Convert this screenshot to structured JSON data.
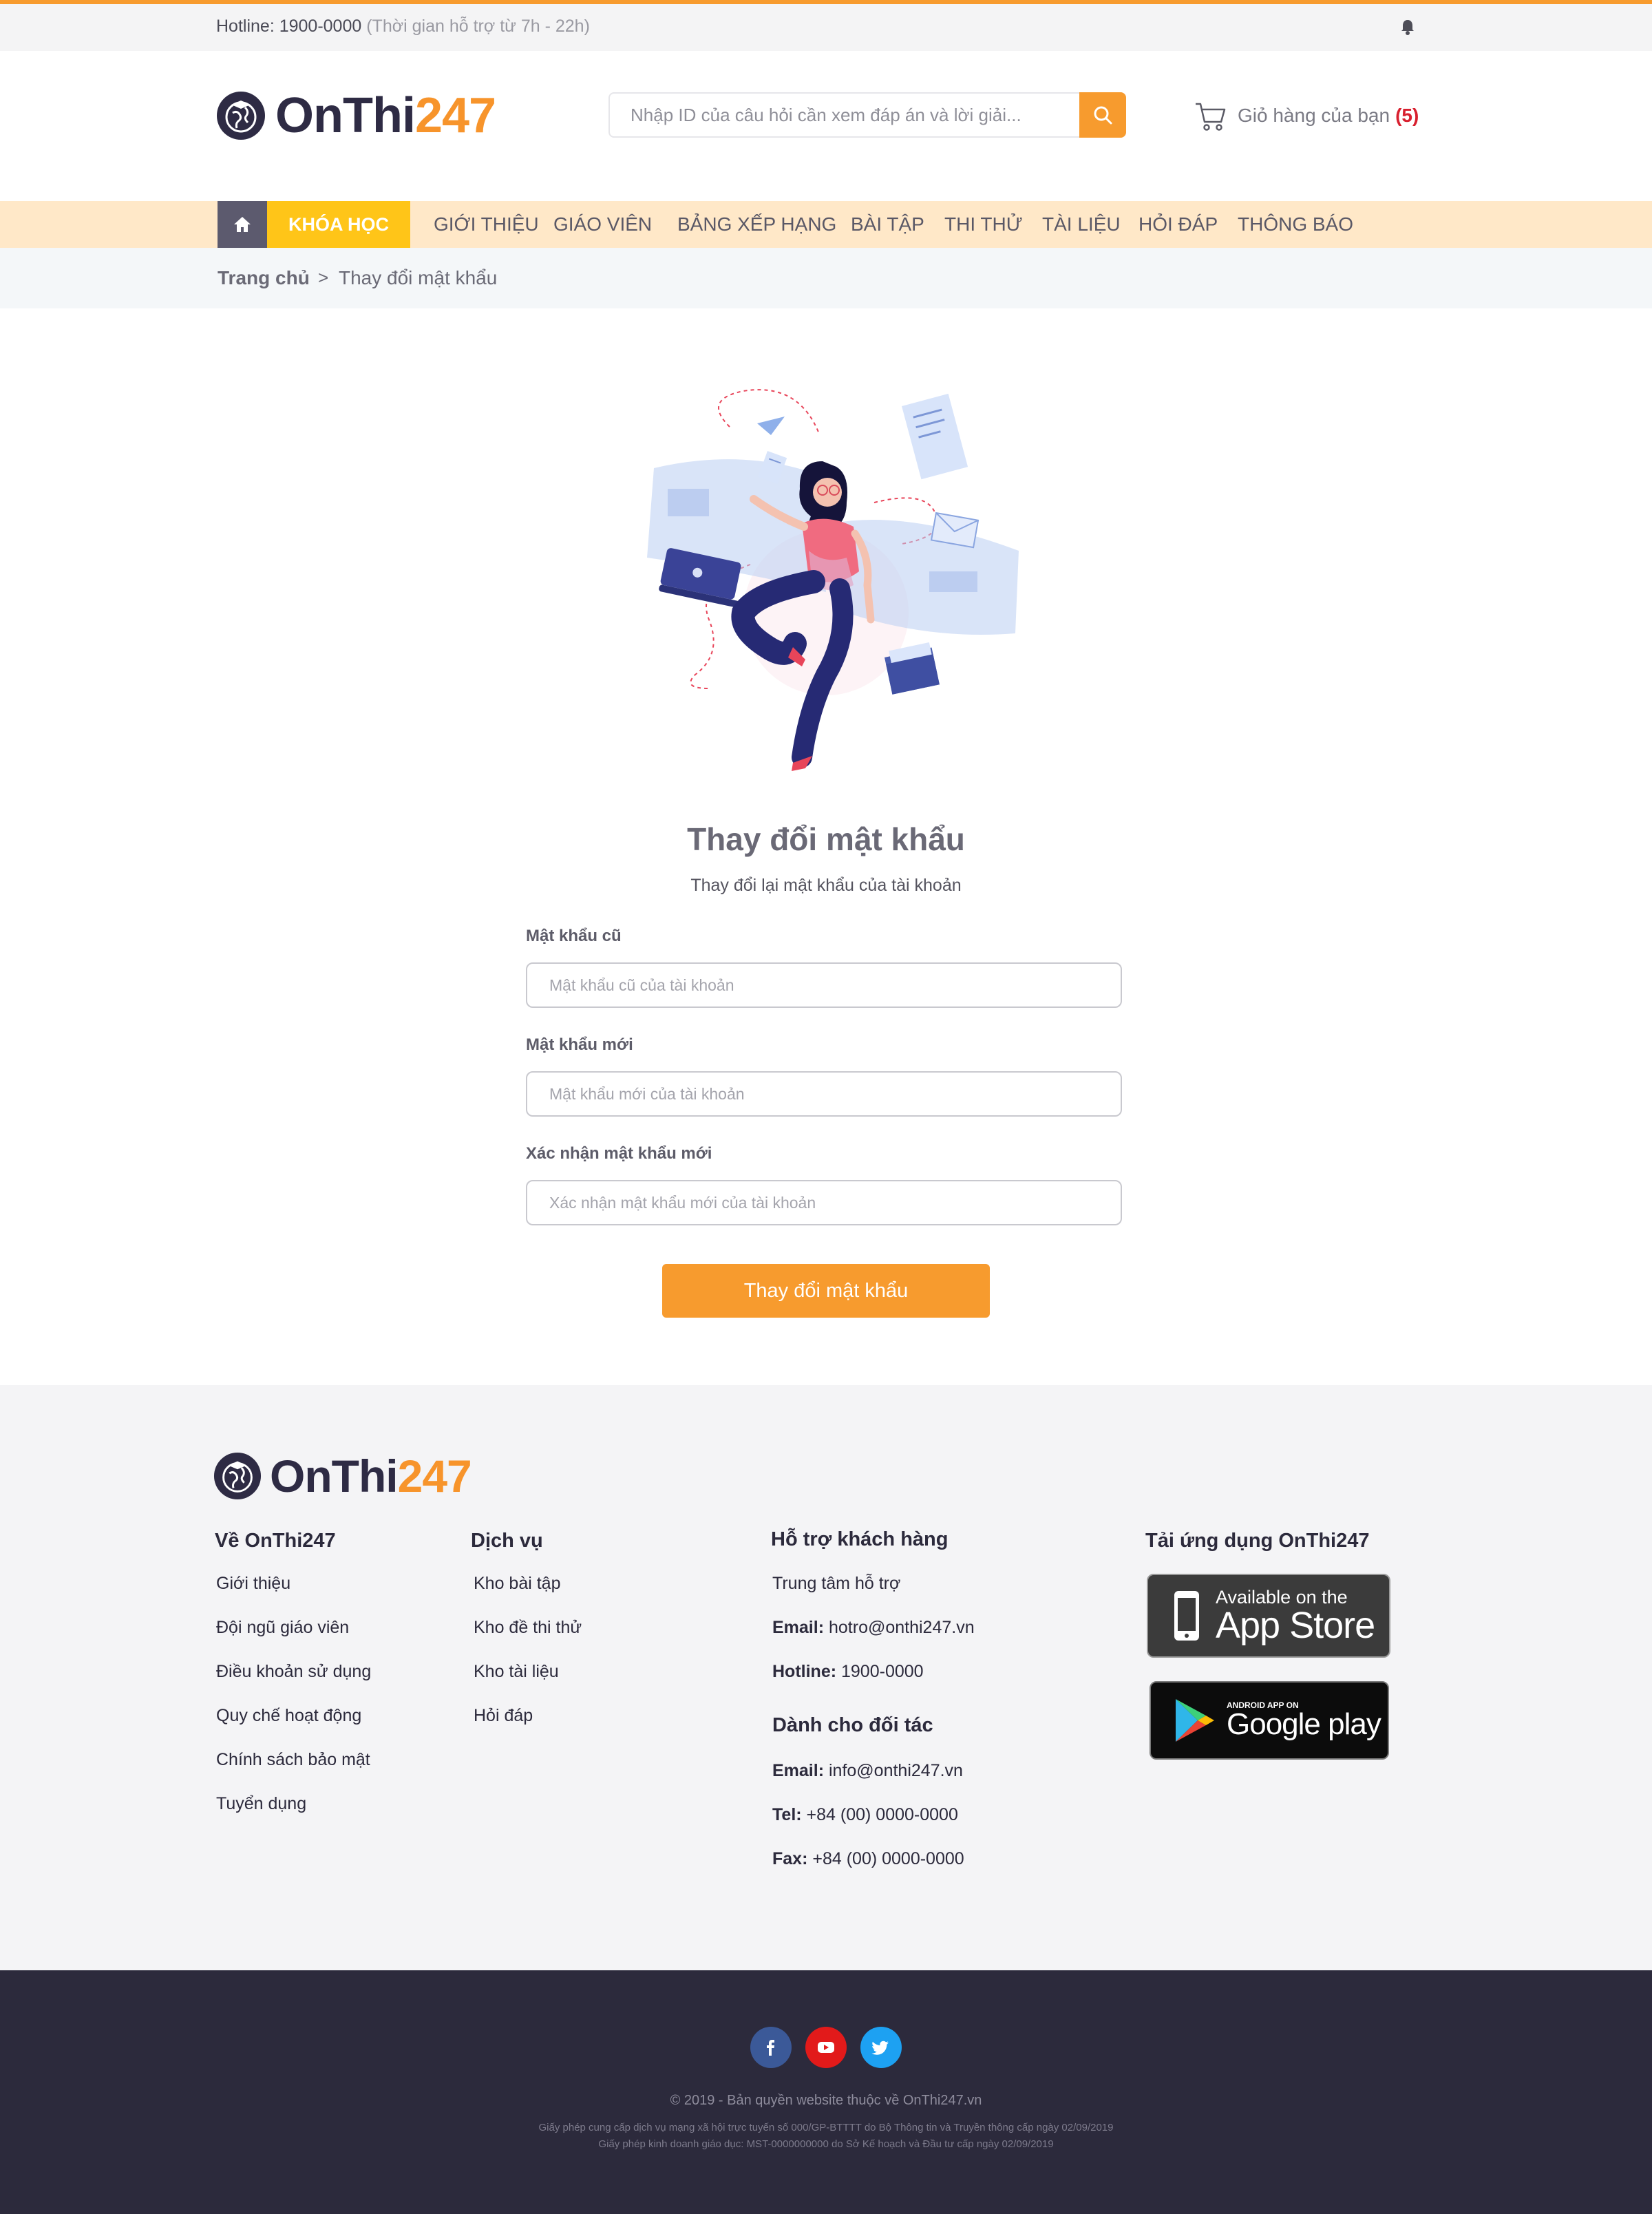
{
  "topbar": {
    "hotline": "Hotline: 1900-0000",
    "support_hours": "(Thời gian hỗ trợ từ 7h - 22h)",
    "bell_icon": "bell-icon"
  },
  "header": {
    "brand_on": "OnThi",
    "brand_num": "247",
    "search_placeholder": "Nhập ID của câu hỏi cần xem đáp án và lời giải...",
    "cart_label": "Giỏ hàng của bạn",
    "cart_count": "(5)"
  },
  "nav": {
    "home_icon": "home-icon",
    "courses": "KHÓA HỌC",
    "items": [
      "GIỚI THIỆU",
      "GIÁO VIÊN",
      "BẢNG XẾP HẠNG",
      "BÀI TẬP",
      "THI THỬ",
      "TÀI LIỆU",
      "HỎI ĐÁP",
      "THÔNG BÁO"
    ]
  },
  "breadcrumb": {
    "home": "Trang chủ",
    "separator": ">",
    "current": "Thay đổi mật khẩu"
  },
  "form": {
    "title": "Thay đổi mật khẩu",
    "subtitle": "Thay đổi lại mật khẩu của tài khoản",
    "old_label": "Mật khẩu cũ",
    "old_placeholder": "Mật khẩu cũ của tài khoản",
    "new_label": "Mật khẩu mới",
    "new_placeholder": "Mật khẩu mới của tài khoản",
    "confirm_label": "Xác nhận mật khẩu mới",
    "confirm_placeholder": "Xác nhận mật khẩu mới của tài khoản",
    "submit": "Thay đổi mật khẩu"
  },
  "footer": {
    "about": {
      "heading": "Về OnThi247",
      "links": [
        "Giới thiệu",
        "Đội ngũ giáo viên",
        "Điều khoản sử dụng",
        "Quy chế hoạt động",
        "Chính sách bảo mật",
        "Tuyển dụng"
      ]
    },
    "services": {
      "heading": "Dịch vụ",
      "links": [
        "Kho bài tập",
        "Kho đề thi thử",
        "Kho tài liệu",
        "Hỏi đáp"
      ]
    },
    "support": {
      "heading": "Hỗ trợ khách hàng",
      "center": "Trung tâm hỗ trợ",
      "email_label": "Email:",
      "email": "hotro@onthi247.vn",
      "hotline_label": "Hotline:",
      "hotline": "1900-0000"
    },
    "partners": {
      "heading": "Dành cho đối tác",
      "email_label": "Email:",
      "email": "info@onthi247.vn",
      "tel_label": "Tel:",
      "tel": "+84 (00) 0000-0000",
      "fax_label": "Fax:",
      "fax": "+84 (00) 0000-0000"
    },
    "apps": {
      "heading": "Tải ứng dụng OnThi247",
      "appstore_small": "Available on the",
      "appstore_big": "App Store",
      "gplay_small": "ANDROID APP ON",
      "gplay_big": "Google play"
    }
  },
  "bottom": {
    "social_icons": [
      "facebook-icon",
      "youtube-icon",
      "twitter-icon"
    ],
    "colors": {
      "facebook": "#3b5998",
      "youtube": "#e21a1a",
      "twitter": "#1da1f2"
    },
    "copyright": "© 2019 - Bản quyền website thuộc về OnThi247.vn",
    "license1": "Giấy phép cung cấp dịch vụ mạng xã hội trực tuyến số 000/GP-BTTTT do Bộ Thông tin và Truyền thông cấp ngày 02/09/2019",
    "license2": "Giấy phép kinh doanh giáo dục: MST-0000000000 do Sở Kế hoạch và Đầu tư cấp ngày 02/09/2019"
  },
  "colors": {
    "accent": "#f79b2e",
    "courses_tab": "#ffc518",
    "nav_bg": "#ffe8c8",
    "dark": "#2c2a3c"
  }
}
